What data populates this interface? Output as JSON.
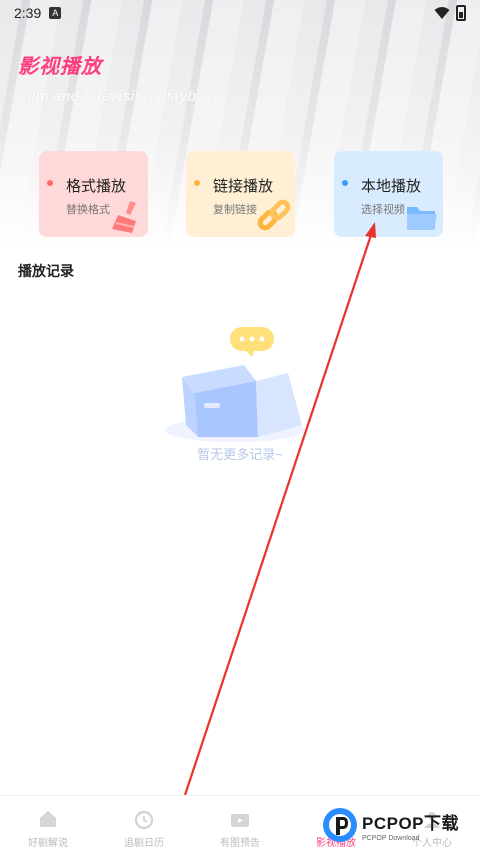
{
  "status_bar": {
    "time": "2:39",
    "notification_badge": "A"
  },
  "header": {
    "title": "影视播放",
    "subtitle": "Film and television playback"
  },
  "cards": [
    {
      "title": "格式播放",
      "subtitle": "替换格式",
      "icon": "brush-icon",
      "color": "#ffd9da"
    },
    {
      "title": "链接播放",
      "subtitle": "复制链接",
      "icon": "link-icon",
      "color": "#fff0d5"
    },
    {
      "title": "本地播放",
      "subtitle": "选择视频",
      "icon": "folder-icon",
      "color": "#d9ecff"
    }
  ],
  "history": {
    "title": "播放记录",
    "empty_text": "暂无更多记录~"
  },
  "bottom_nav": [
    {
      "label": "好剧解说",
      "icon": "home-icon"
    },
    {
      "label": "追剧日历",
      "icon": "alarm-clock-icon"
    },
    {
      "label": "有图预告",
      "icon": "tv-icon"
    },
    {
      "label": "影视播放",
      "icon": "play-icon",
      "active": true
    },
    {
      "label": "个人中心",
      "icon": "user-icon"
    }
  ],
  "watermark": {
    "main": "PCPOP下载",
    "sub": "PCPOP Download"
  },
  "colors": {
    "accent": "#ff3d7f",
    "annotation_arrow": "#e8322a"
  }
}
